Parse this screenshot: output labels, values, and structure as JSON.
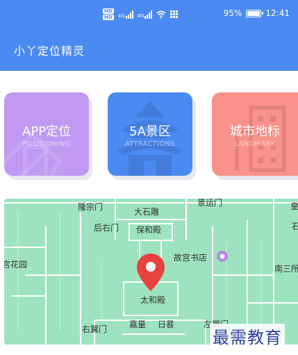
{
  "status_bar": {
    "hd_top": "HD",
    "hd_bottom": "HD",
    "signal_1": "4G",
    "signal_2": "4G",
    "battery": "95%",
    "time": "12:41"
  },
  "app": {
    "title": "小丫定位精灵"
  },
  "cards": [
    {
      "title": "APP定位",
      "subtitle": "POSITIONING",
      "color": "#c09af2"
    },
    {
      "title": "5A景区",
      "subtitle": "ATTRACTIONS",
      "color": "#4a8af1"
    },
    {
      "title": "城市地标",
      "subtitle": "LANDMARK",
      "color": "#f9928a"
    }
  ],
  "map": {
    "labels": [
      "隆宗门",
      "大石雕",
      "景运门",
      "皇",
      "后右门",
      "保和殿",
      "石",
      "宫花园",
      "故宫书店",
      "南三所",
      "太和殿",
      "右翼门",
      "嘉量",
      "日晷",
      "左翼门"
    ],
    "pin_color": "#e8423f",
    "poi_color": "#b58ce0"
  },
  "watermark": "最需教育"
}
